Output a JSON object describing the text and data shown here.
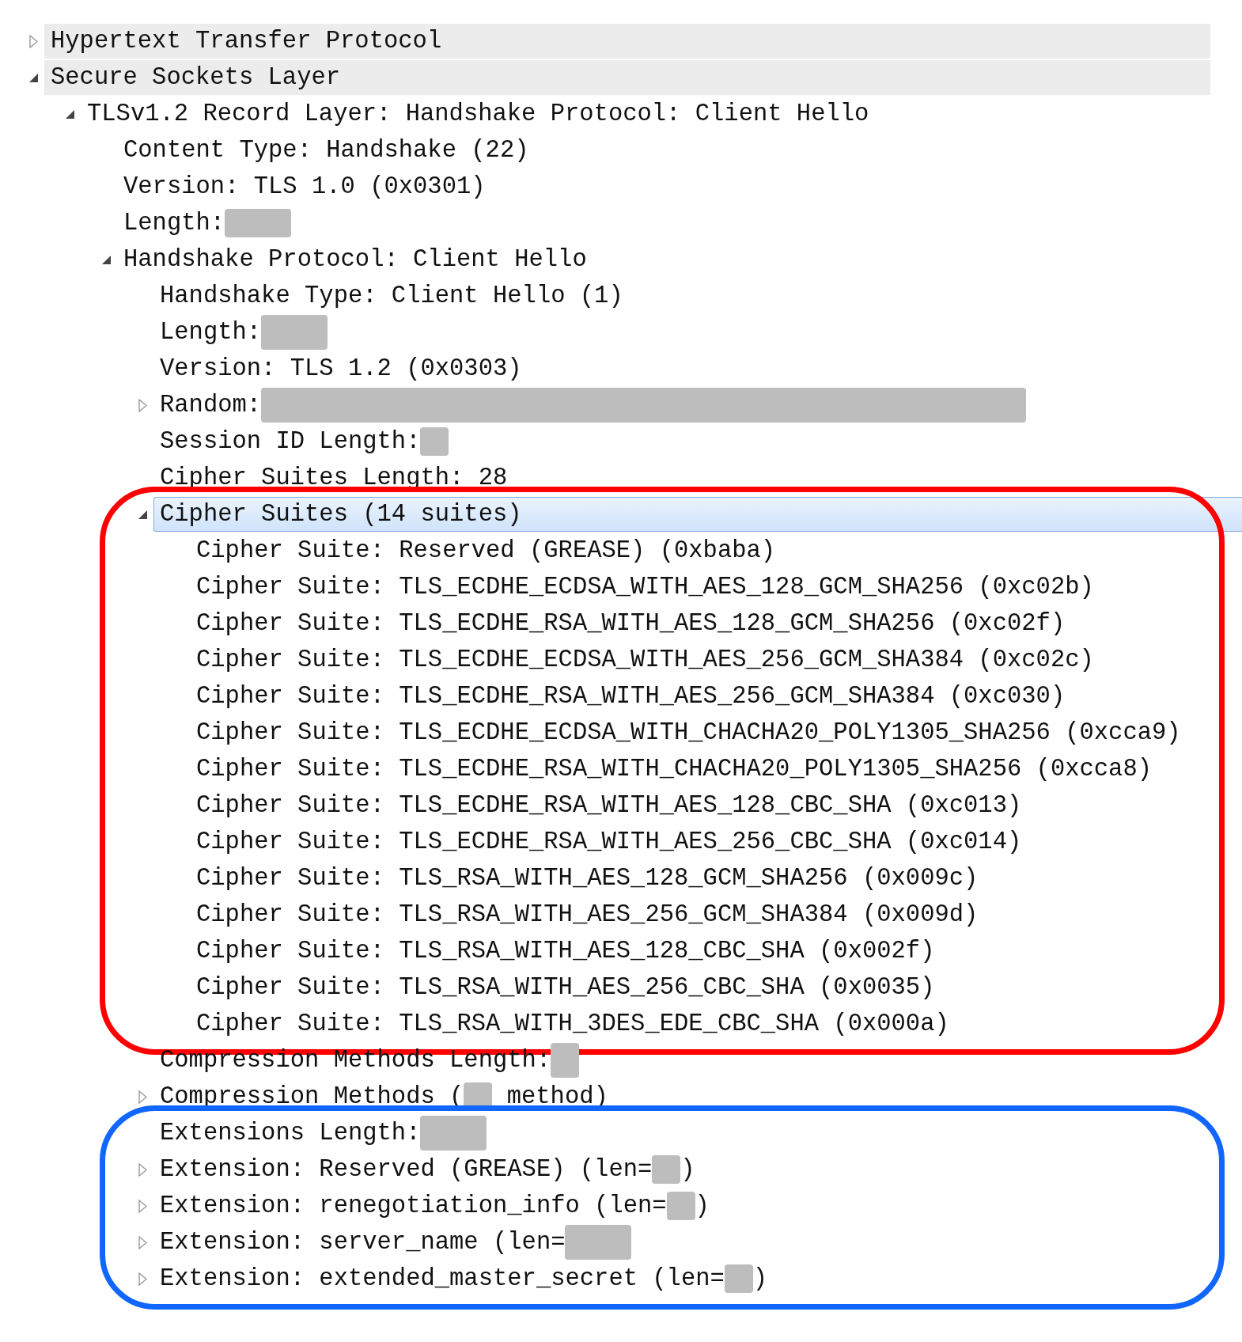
{
  "tree": [
    {
      "parts": [
        {
          "kind": "text",
          "text": "Hypertext Transfer Protocol"
        }
      ],
      "expanded": false,
      "shaded": true,
      "selected": false
    },
    {
      "parts": [
        {
          "kind": "text",
          "text": "Secure Sockets Layer"
        }
      ],
      "expanded": true,
      "shaded": true,
      "selected": false,
      "children": [
        {
          "parts": [
            {
              "kind": "text",
              "text": "TLSv1.2 Record Layer: Handshake Protocol: Client Hello"
            }
          ],
          "expanded": true,
          "selected": false,
          "children": [
            {
              "parts": [
                {
                  "kind": "text",
                  "text": "Content Type: Handshake (22)"
                }
              ],
              "selected": false
            },
            {
              "parts": [
                {
                  "kind": "text",
                  "text": "Version: TLS 1.0 (0x0301)"
                }
              ],
              "selected": false
            },
            {
              "parts": [
                {
                  "kind": "text",
                  "text": "Length:"
                },
                {
                  "kind": "redacted"
                }
              ],
              "selected": false
            },
            {
              "parts": [
                {
                  "kind": "text",
                  "text": "Handshake Protocol: Client Hello"
                }
              ],
              "expanded": true,
              "selected": false,
              "children": [
                {
                  "parts": [
                    {
                      "kind": "text",
                      "text": "Handshake Type: Client Hello (1)"
                    }
                  ],
                  "selected": false
                },
                {
                  "parts": [
                    {
                      "kind": "text",
                      "text": "Length:"
                    },
                    {
                      "kind": "redacted",
                      "tall": true
                    }
                  ],
                  "selected": false
                },
                {
                  "parts": [
                    {
                      "kind": "text",
                      "text": "Version: TLS 1.2 (0x0303)"
                    }
                  ],
                  "selected": false
                },
                {
                  "parts": [
                    {
                      "kind": "text",
                      "text": "Random:"
                    },
                    {
                      "kind": "redacted",
                      "wide": true,
                      "tall": true
                    }
                  ],
                  "expanded": false,
                  "selected": false
                },
                {
                  "parts": [
                    {
                      "kind": "text",
                      "text": "Session ID Length:"
                    },
                    {
                      "kind": "redacted",
                      "narrow": true
                    }
                  ],
                  "selected": false
                },
                {
                  "parts": [
                    {
                      "kind": "text",
                      "text": "Cipher Suites Length: 28"
                    }
                  ],
                  "selected": false
                },
                {
                  "parts": [
                    {
                      "kind": "text",
                      "text": "Cipher Suites (14 suites)"
                    }
                  ],
                  "expanded": true,
                  "selected": true,
                  "annotation": {
                    "color": "#ff0000"
                  },
                  "children": [
                    {
                      "parts": [
                        {
                          "kind": "text",
                          "text": "Cipher Suite: Reserved (GREASE) (0xbaba)"
                        }
                      ],
                      "selected": false
                    },
                    {
                      "parts": [
                        {
                          "kind": "text",
                          "text": "Cipher Suite: TLS_ECDHE_ECDSA_WITH_AES_128_GCM_SHA256 (0xc02b)"
                        }
                      ],
                      "selected": false
                    },
                    {
                      "parts": [
                        {
                          "kind": "text",
                          "text": "Cipher Suite: TLS_ECDHE_RSA_WITH_AES_128_GCM_SHA256 (0xc02f)"
                        }
                      ],
                      "selected": false
                    },
                    {
                      "parts": [
                        {
                          "kind": "text",
                          "text": "Cipher Suite: TLS_ECDHE_ECDSA_WITH_AES_256_GCM_SHA384 (0xc02c)"
                        }
                      ],
                      "selected": false
                    },
                    {
                      "parts": [
                        {
                          "kind": "text",
                          "text": "Cipher Suite: TLS_ECDHE_RSA_WITH_AES_256_GCM_SHA384 (0xc030)"
                        }
                      ],
                      "selected": false
                    },
                    {
                      "parts": [
                        {
                          "kind": "text",
                          "text": "Cipher Suite: TLS_ECDHE_ECDSA_WITH_CHACHA20_POLY1305_SHA256 (0xcca9)"
                        }
                      ],
                      "selected": false
                    },
                    {
                      "parts": [
                        {
                          "kind": "text",
                          "text": "Cipher Suite: TLS_ECDHE_RSA_WITH_CHACHA20_POLY1305_SHA256 (0xcca8)"
                        }
                      ],
                      "selected": false
                    },
                    {
                      "parts": [
                        {
                          "kind": "text",
                          "text": "Cipher Suite: TLS_ECDHE_RSA_WITH_AES_128_CBC_SHA (0xc013)"
                        }
                      ],
                      "selected": false
                    },
                    {
                      "parts": [
                        {
                          "kind": "text",
                          "text": "Cipher Suite: TLS_ECDHE_RSA_WITH_AES_256_CBC_SHA (0xc014)"
                        }
                      ],
                      "selected": false
                    },
                    {
                      "parts": [
                        {
                          "kind": "text",
                          "text": "Cipher Suite: TLS_RSA_WITH_AES_128_GCM_SHA256 (0x009c)"
                        }
                      ],
                      "selected": false
                    },
                    {
                      "parts": [
                        {
                          "kind": "text",
                          "text": "Cipher Suite: TLS_RSA_WITH_AES_256_GCM_SHA384 (0x009d)"
                        }
                      ],
                      "selected": false
                    },
                    {
                      "parts": [
                        {
                          "kind": "text",
                          "text": "Cipher Suite: TLS_RSA_WITH_AES_128_CBC_SHA (0x002f)"
                        }
                      ],
                      "selected": false
                    },
                    {
                      "parts": [
                        {
                          "kind": "text",
                          "text": "Cipher Suite: TLS_RSA_WITH_AES_256_CBC_SHA (0x0035)"
                        }
                      ],
                      "selected": false
                    },
                    {
                      "parts": [
                        {
                          "kind": "text",
                          "text": "Cipher Suite: TLS_RSA_WITH_3DES_EDE_CBC_SHA (0x000a)"
                        }
                      ],
                      "selected": false
                    }
                  ]
                },
                {
                  "parts": [
                    {
                      "kind": "text",
                      "text": "Compression Methods Length:"
                    },
                    {
                      "kind": "redacted",
                      "narrow": true,
                      "tall": true
                    }
                  ],
                  "selected": false
                },
                {
                  "parts": [
                    {
                      "kind": "text",
                      "text": "Compression Methods ("
                    },
                    {
                      "kind": "redacted",
                      "narrow": true
                    },
                    {
                      "kind": "text",
                      "text": " method)"
                    }
                  ],
                  "expanded": false,
                  "selected": false
                },
                {
                  "annotation": {
                    "color": "#1166ff"
                  },
                  "members": [
                    {
                      "parts": [
                        {
                          "kind": "text",
                          "text": "Extensions Length:"
                        },
                        {
                          "kind": "redacted",
                          "tall": true
                        }
                      ],
                      "selected": false
                    },
                    {
                      "parts": [
                        {
                          "kind": "text",
                          "text": "Extension: Reserved (GREASE) (len="
                        },
                        {
                          "kind": "redacted",
                          "narrow": true
                        },
                        {
                          "kind": "text",
                          "text": ")"
                        }
                      ],
                      "expanded": false,
                      "selected": false
                    },
                    {
                      "parts": [
                        {
                          "kind": "text",
                          "text": "Extension: renegotiation_info (len="
                        },
                        {
                          "kind": "redacted",
                          "narrow": true
                        },
                        {
                          "kind": "text",
                          "text": ")"
                        }
                      ],
                      "expanded": false,
                      "selected": false
                    },
                    {
                      "parts": [
                        {
                          "kind": "text",
                          "text": "Extension: server_name (len="
                        },
                        {
                          "kind": "redacted",
                          "tall": true
                        }
                      ],
                      "expanded": false,
                      "selected": false
                    },
                    {
                      "parts": [
                        {
                          "kind": "text",
                          "text": "Extension: extended_master_secret (len="
                        },
                        {
                          "kind": "redacted",
                          "narrow": true
                        },
                        {
                          "kind": "text",
                          "text": ")"
                        }
                      ],
                      "expanded": false,
                      "selected": false
                    }
                  ]
                }
              ]
            }
          ]
        }
      ]
    }
  ]
}
